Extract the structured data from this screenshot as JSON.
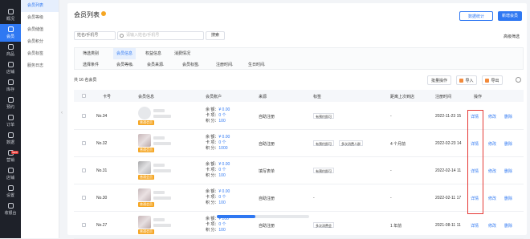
{
  "left_nav": [
    {
      "label": "概况",
      "icon": "overview-icon",
      "active": false
    },
    {
      "label": "会员",
      "icon": "member-icon",
      "active": true
    },
    {
      "label": "商品",
      "icon": "goods-icon",
      "active": false
    },
    {
      "label": "店铺",
      "icon": "store-icon",
      "active": false
    },
    {
      "label": "库存",
      "icon": "inventory-icon",
      "active": false
    },
    {
      "label": "预约",
      "icon": "booking-icon",
      "active": false
    },
    {
      "label": "订单",
      "icon": "order-icon",
      "active": false
    },
    {
      "label": "数据",
      "icon": "data-icon",
      "active": false
    },
    {
      "label": "营销",
      "icon": "marketing-icon",
      "active": false,
      "badge": "NEW"
    },
    {
      "label": "店铺",
      "icon": "shop-icon",
      "active": false
    },
    {
      "label": "设置",
      "icon": "settings-icon",
      "active": false
    },
    {
      "label": "收银台",
      "icon": "cashier-icon",
      "active": false
    }
  ],
  "sub_nav": [
    {
      "label": "会员列表",
      "active": true
    },
    {
      "label": "会员等级",
      "active": false
    },
    {
      "label": "会员储值",
      "active": false
    },
    {
      "label": "会员积分",
      "active": false
    },
    {
      "label": "会员标签",
      "active": false
    },
    {
      "label": "服务日志",
      "active": false
    }
  ],
  "page": {
    "title": "会员列表",
    "data_stats": "数据统计",
    "new_member": "新增会员"
  },
  "search": {
    "keyword_select": "姓名/手机号",
    "placeholder": "请输入姓名/手机号",
    "button": "搜索",
    "advanced": "高级筛选"
  },
  "filter": {
    "row1_label": "筛选类别",
    "row1_chips": [
      {
        "label": "会员信息",
        "active": true
      },
      {
        "label": "权益信息",
        "active": false
      },
      {
        "label": "消费情况",
        "active": false
      }
    ],
    "row2_label": "选择条件",
    "row2_chips": [
      "会员等级",
      "会员来源",
      "会员标签",
      "注册时间",
      "生日时间"
    ]
  },
  "toolbar": {
    "count": "共 16 名会员",
    "col_settings": "批量操作",
    "import": "导入",
    "export": "导出"
  },
  "table": {
    "headers": {
      "no": "卡号",
      "info": "会员信息",
      "account": "会员账户",
      "source": "来源",
      "tags": "标签",
      "last_visit": "距离上次到店",
      "reg_time": "注册时间",
      "ops": "操作"
    },
    "account_labels": {
      "balance": "余 额：",
      "cards": "卡 项：",
      "points": "积 分："
    },
    "ops": {
      "detail": "详情",
      "edit": "修改",
      "delete": "删除"
    },
    "rows": [
      {
        "no": "No.34",
        "vip": "普通会员",
        "balance": "¥ 0.00",
        "cards": "0 个",
        "points": "100",
        "source": "自助注册",
        "tags": [
          "有预约即可"
        ],
        "last_visit": "-",
        "reg_time": "2022-11-23 15"
      },
      {
        "no": "No.32",
        "vip": "普通会员",
        "balance": "¥ 0.00",
        "cards": "0 个",
        "points": "1000",
        "source": "自助注册",
        "tags": [
          "有预约即可",
          "多次消费人群"
        ],
        "last_visit": "4 个月前",
        "reg_time": "2022-02-23 14"
      },
      {
        "no": "No.31",
        "vip": "普通会员",
        "balance": "¥ 0.00",
        "cards": "0 个",
        "points": "100",
        "source": "填写表单",
        "tags": [
          "有预约即可"
        ],
        "last_visit": "-",
        "reg_time": "2022-02-14 11"
      },
      {
        "no": "No.30",
        "vip": "普通会员",
        "balance": "¥ 0.00",
        "cards": "0 个",
        "points": "100",
        "source": "自助注册",
        "tags": [],
        "last_visit": "-",
        "reg_time": "2022-02-11 17"
      },
      {
        "no": "No.27",
        "vip": "普通会员",
        "balance": "¥ 200",
        "cards": "0 个",
        "points": "100",
        "source": "自助注册",
        "tags": [
          "多次消费会"
        ],
        "last_visit": "1 年前",
        "reg_time": "2021-08-11 11"
      }
    ]
  },
  "scroll_progress": 0.42,
  "colors": {
    "primary": "#2f78f2",
    "nav_bg": "#1e2129",
    "highlight": "#e53935",
    "vip": "#f5a623"
  }
}
